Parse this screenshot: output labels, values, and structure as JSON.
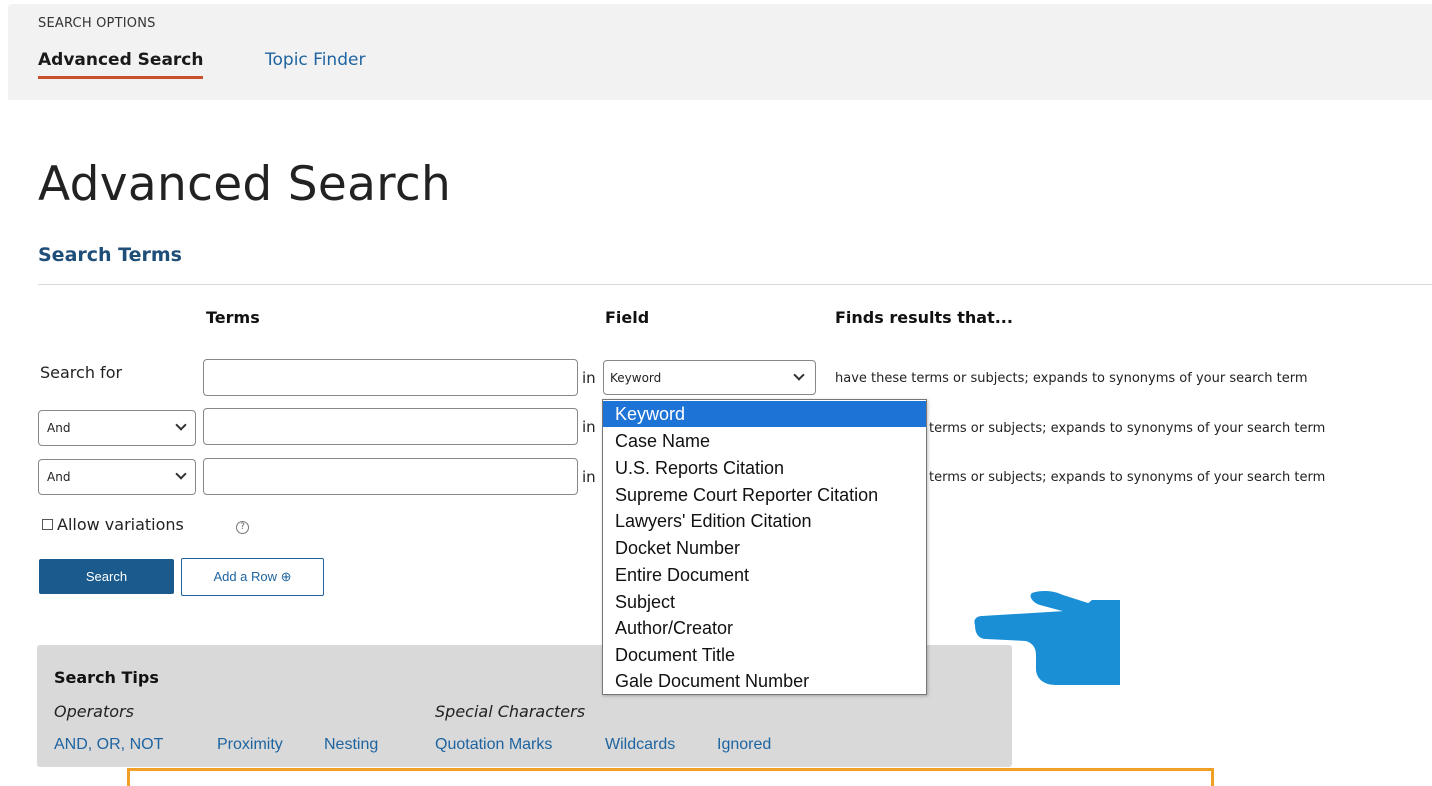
{
  "topbar": {
    "section_label": "SEARCH OPTIONS",
    "tabs": [
      {
        "label": "Advanced Search",
        "active": true
      },
      {
        "label": "Topic Finder",
        "active": false
      }
    ]
  },
  "main": {
    "title": "Advanced Search",
    "section_title": "Search Terms",
    "column_headers": {
      "terms": "Terms",
      "field": "Field",
      "finds": "Finds results that..."
    },
    "rows": [
      {
        "label": "Search for",
        "operator": null,
        "term_value": "",
        "in_word": "in",
        "field": "Keyword",
        "finds_text": "have these terms or subjects; expands to synonyms of your search term"
      },
      {
        "label": null,
        "operator": "And",
        "term_value": "",
        "in_word": "in",
        "field": null,
        "finds_text": "terms or subjects; expands to synonyms of your search term"
      },
      {
        "label": null,
        "operator": "And",
        "term_value": "",
        "in_word": "in",
        "field": null,
        "finds_text": "terms or subjects; expands to synonyms of your search term"
      }
    ],
    "allow_variations": {
      "label": "Allow variations",
      "checked": false,
      "help_glyph": "?"
    },
    "buttons": {
      "search": "Search",
      "add_row": "Add a Row ⊕"
    }
  },
  "field_dropdown": {
    "selected": "Keyword",
    "options": [
      "Keyword",
      "Case Name",
      "U.S. Reports Citation",
      "Supreme Court Reporter Citation",
      "Lawyers' Edition Citation",
      "Docket Number",
      "Entire Document",
      "Subject",
      "Author/Creator",
      "Document Title",
      "Gale Document Number"
    ]
  },
  "search_tips": {
    "title": "Search Tips",
    "operators_heading": "Operators",
    "operators": [
      "AND, OR, NOT",
      "Proximity",
      "Nesting"
    ],
    "special_heading": "Special Characters",
    "special": [
      "Quotation Marks",
      "Wildcards",
      "Ignored"
    ]
  },
  "colors": {
    "accent_blue": "#1a5a8c",
    "link_blue": "#1e64a0",
    "tab_underline": "#c8502a",
    "dropdown_highlight": "#1e74d6",
    "pointer_hand": "#1b8fd6",
    "callout_border": "#f0a024"
  },
  "icons": {
    "help": "question-circle-icon",
    "pointer": "pointing-hand-icon",
    "select_caret": "chevron-down-icon"
  }
}
